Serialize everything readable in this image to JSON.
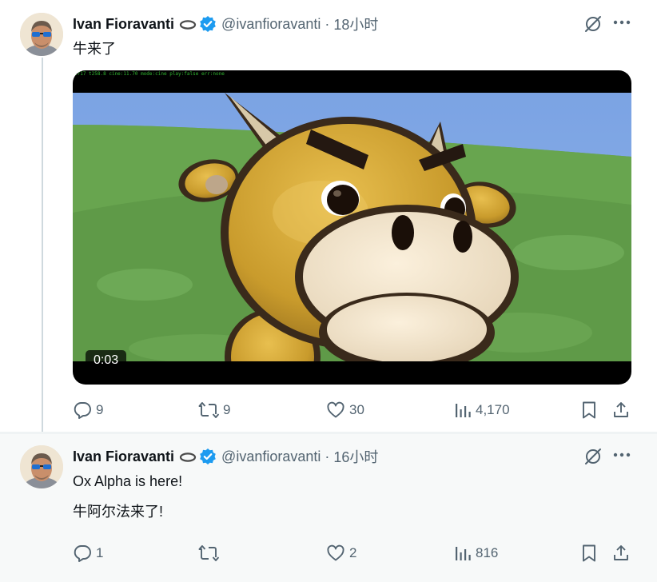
{
  "tweets": [
    {
      "name": "Ivan Fioravanti",
      "handle": "@ivanfioravanti",
      "separator": "·",
      "time": "18小时",
      "text": "牛来了",
      "media": {
        "type": "video",
        "duration": "0:03",
        "debug_overlay": "1717 t258.8 cine:11.70 mode:cine play:false err:none"
      },
      "stats": {
        "replies": "9",
        "reposts": "9",
        "likes": "30",
        "views": "4,170"
      }
    },
    {
      "name": "Ivan Fioravanti",
      "handle": "@ivanfioravanti",
      "separator": "·",
      "time": "16小时",
      "text_lines": [
        "Ox Alpha is here!",
        "牛阿尔法来了!"
      ],
      "stats": {
        "replies": "1",
        "reposts": "",
        "likes": "2",
        "views": "816"
      }
    }
  ],
  "icons": {
    "ring": "ring-emoji-icon",
    "verified": "verified-badge-icon",
    "grok": "grok-icon",
    "more": "more-icon",
    "reply": "reply-icon",
    "repost": "repost-icon",
    "like": "like-icon",
    "views": "views-icon",
    "bookmark": "bookmark-icon",
    "share": "share-icon"
  },
  "colors": {
    "verified": "#1d9bf0",
    "muted": "#536471",
    "text": "#0f1419",
    "thread_line": "#cfd9de"
  }
}
